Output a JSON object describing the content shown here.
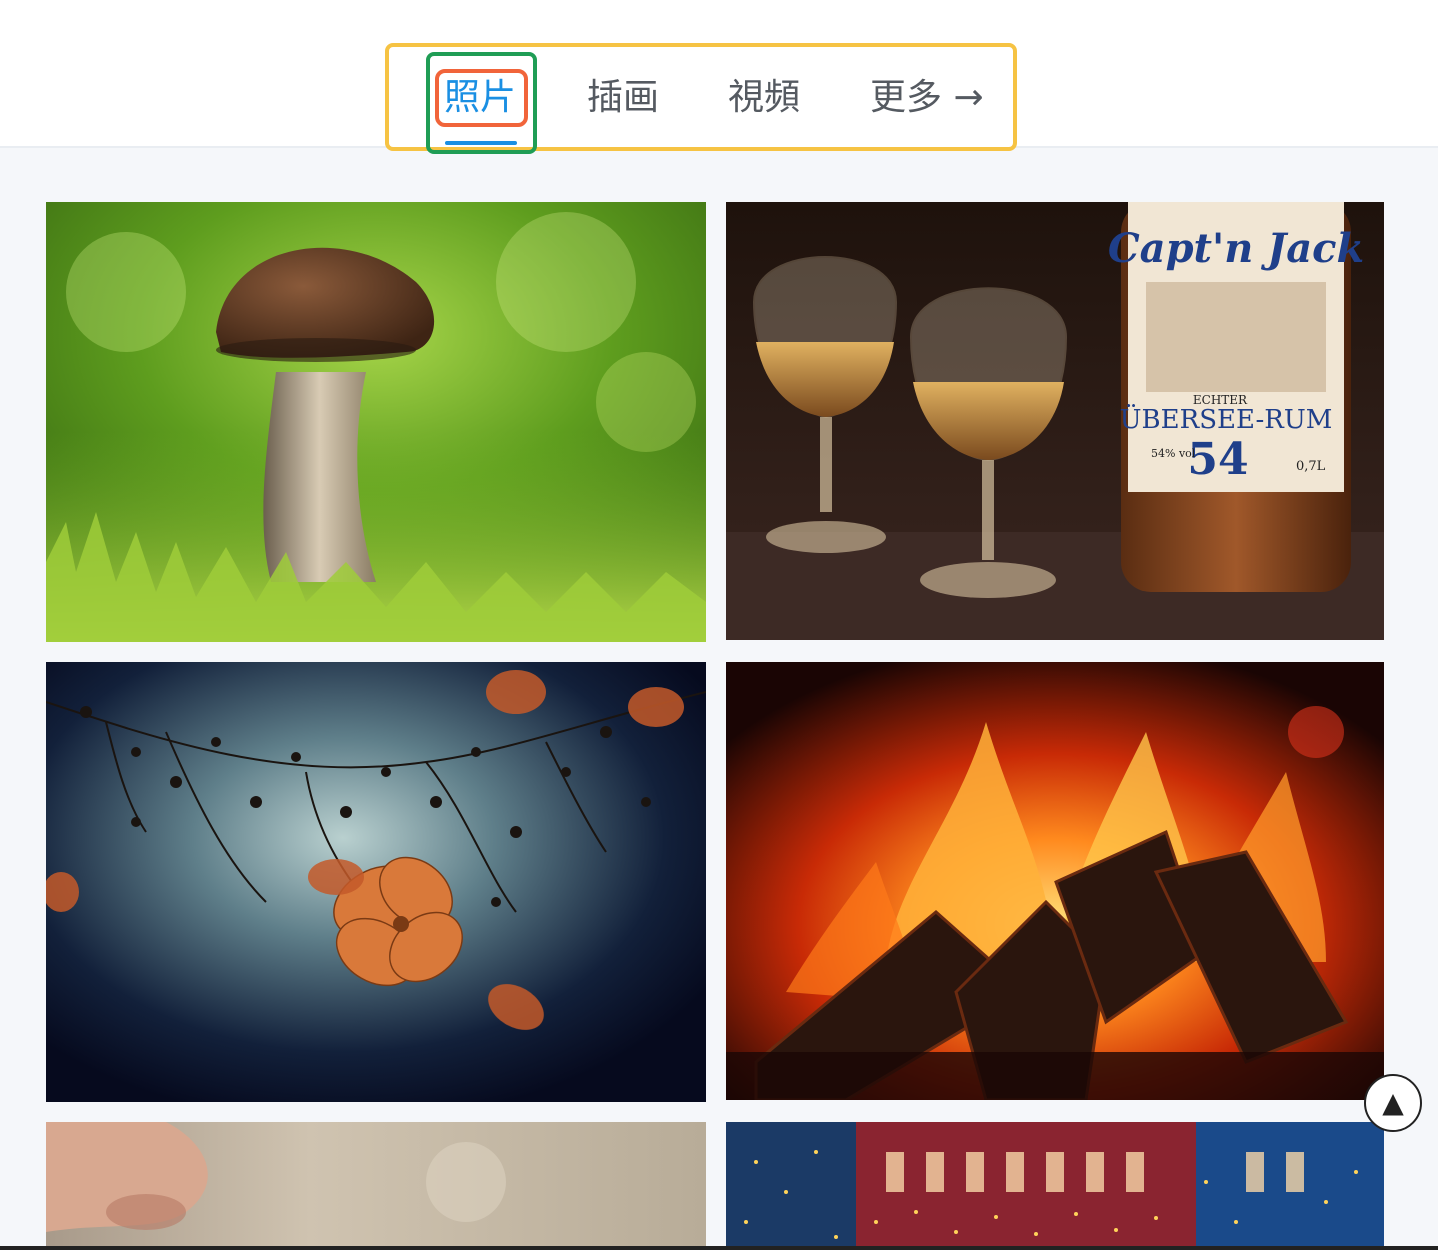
{
  "tabs": [
    {
      "label": "照片",
      "active": true
    },
    {
      "label": "插画",
      "active": false
    },
    {
      "label": "視頻",
      "active": false
    },
    {
      "label": "更多 →",
      "active": false
    }
  ],
  "colors": {
    "accent": "#1a8fe3",
    "highlight_outer": "#f6c343",
    "highlight_active": "#1f9d55",
    "highlight_label": "#f1643a"
  },
  "photos": [
    {
      "name": "mushroom-photo"
    },
    {
      "name": "rum-glasses-photo",
      "label_brand": "Capt'n Jack",
      "label_line1": "ECHTER",
      "label_line2": "ÜBERSEE-RUM",
      "label_number": "54",
      "label_abv": "54% vol",
      "label_volume": "0,7L"
    },
    {
      "name": "autumn-flowers-photo"
    },
    {
      "name": "campfire-photo"
    },
    {
      "name": "portrait-photo"
    },
    {
      "name": "city-lights-photo"
    }
  ],
  "scroll_top": {
    "icon": "arrow-up-icon",
    "glyph": "▲"
  }
}
